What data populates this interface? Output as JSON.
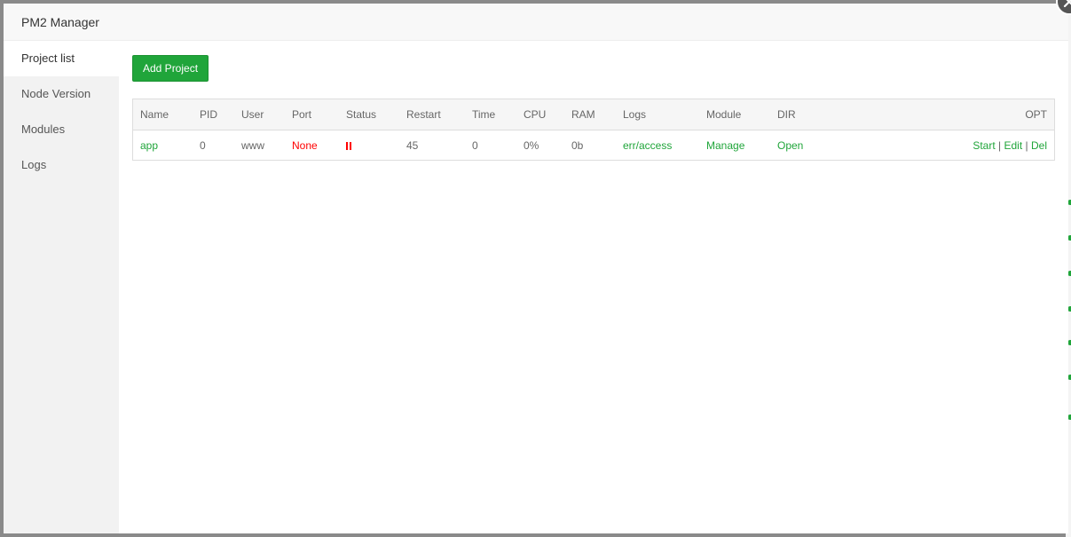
{
  "dialog": {
    "title": "PM2 Manager"
  },
  "sidebar": {
    "items": [
      {
        "label": "Project list",
        "active": true
      },
      {
        "label": "Node Version"
      },
      {
        "label": "Modules"
      },
      {
        "label": "Logs"
      }
    ]
  },
  "toolbar": {
    "add_label": "Add Project"
  },
  "table": {
    "columns": [
      "Name",
      "PID",
      "User",
      "Port",
      "Status",
      "Restart",
      "Time",
      "CPU",
      "RAM",
      "Logs",
      "Module",
      "DIR",
      "OPT"
    ],
    "rows": [
      {
        "name": "app",
        "pid": "0",
        "user": "www",
        "port": "None",
        "status_icon": "pause-icon",
        "restart": "45",
        "time": "0",
        "cpu": "0%",
        "ram": "0b",
        "logs": "err/access",
        "module": "Manage",
        "dir": "Open",
        "opt": {
          "start": "Start",
          "edit": "Edit",
          "del": "Del",
          "sep": "|"
        }
      }
    ]
  },
  "colors": {
    "accent": "#20a53a",
    "danger": "#ff0000",
    "sidebar_bg": "#f2f2f2"
  },
  "icons": {
    "close": "close-icon"
  }
}
